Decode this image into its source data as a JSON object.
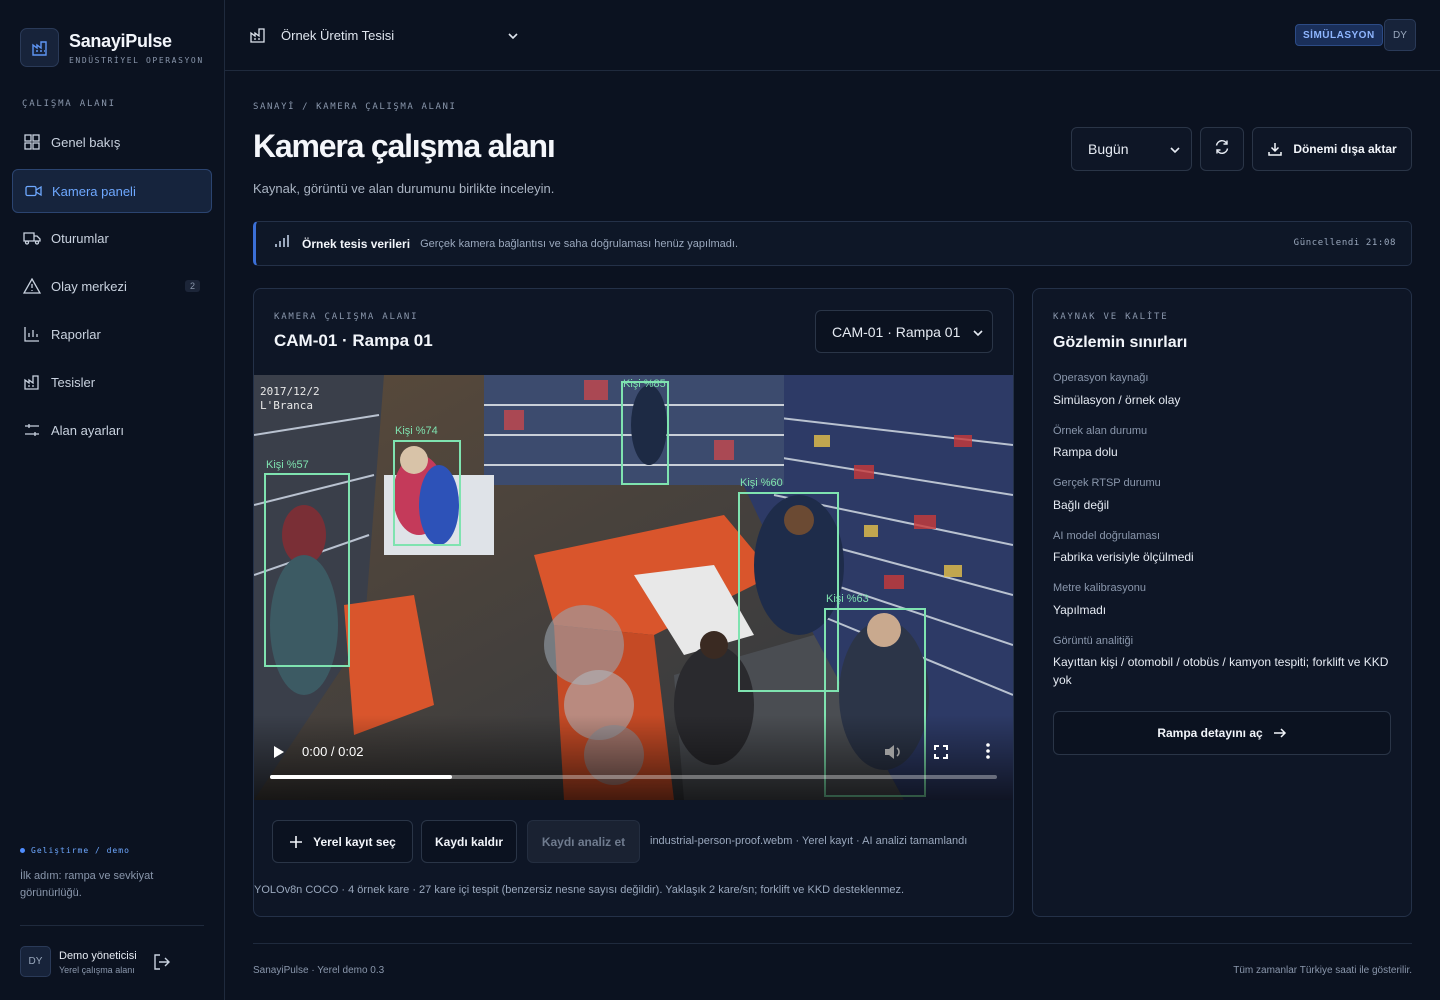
{
  "brand": {
    "name": "SanayiPulse",
    "subtitle": "ENDÜSTRİYEL OPERASYON"
  },
  "sidebar": {
    "section_label": "ÇALIŞMA ALANI",
    "items": [
      {
        "label": "Genel bakış",
        "icon": "grid-icon"
      },
      {
        "label": "Kamera paneli",
        "icon": "video-camera-icon",
        "active": true
      },
      {
        "label": "Oturumlar",
        "icon": "truck-icon"
      },
      {
        "label": "Olay merkezi",
        "icon": "warning-triangle-icon",
        "badge": "2"
      },
      {
        "label": "Raporlar",
        "icon": "bar-chart-icon"
      },
      {
        "label": "Tesisler",
        "icon": "factory-icon"
      },
      {
        "label": "Alan ayarları",
        "icon": "sliders-icon"
      }
    ],
    "env_label": "Geliştirme / demo",
    "env_text": "İlk adım: rampa ve sevkiyat görünürlüğü.",
    "user": {
      "initials": "DY",
      "name": "Demo yöneticisi",
      "role": "Yerel çalışma alanı"
    }
  },
  "topbar": {
    "facility": "Örnek Üretim Tesisi",
    "mode_badge": "SİMÜLASYON",
    "user_initials": "DY"
  },
  "header": {
    "breadcrumb": "SANAYİ / KAMERA ÇALIŞMA ALANI",
    "title": "Kamera çalışma alanı",
    "subtitle": "Kaynak, görüntü ve alan durumunu birlikte inceleyin.",
    "period": "Bugün",
    "export_label": "Dönemi dışa aktar"
  },
  "notice": {
    "title": "Örnek tesis verileri",
    "text": "Gerçek kamera bağlantısı ve saha doğrulaması henüz yapılmadı.",
    "updated": "Güncellendi 21:08"
  },
  "camera": {
    "eyebrow": "KAMERA ÇALIŞMA ALANI",
    "title": "CAM-01 · Rampa 01",
    "selected": "CAM-01 · Rampa 01",
    "stamp_date": "2017/12/2",
    "stamp_loc": "L'Branca",
    "video_time": "0:00 / 0:02",
    "progress": 0.25,
    "detections": [
      {
        "label": "Kişi %57"
      },
      {
        "label": "Kişi %74"
      },
      {
        "label": "Kişi %85"
      },
      {
        "label": "Kişi %60"
      },
      {
        "label": "Kişi %63"
      }
    ],
    "buttons": {
      "select": "Yerel kayıt seç",
      "remove": "Kaydı kaldır",
      "analyze": "Kaydı analiz et"
    },
    "record_info": "industrial-person-proof.webm · Yerel kayıt · AI analizi tamamlandı",
    "model_info": "YOLOv8n COCO · 4 örnek kare · 27 kare içi tespit (benzersiz nesne sayısı değildir). Yaklaşık 2 kare/sn; forklift ve KKD desteklenmez."
  },
  "source": {
    "eyebrow": "KAYNAK VE KALİTE",
    "title": "Gözlemin sınırları",
    "items": [
      {
        "label": "Operasyon kaynağı",
        "value": "Simülasyon / örnek olay"
      },
      {
        "label": "Örnek alan durumu",
        "value": "Rampa dolu"
      },
      {
        "label": "Gerçek RTSP durumu",
        "value": "Bağlı değil"
      },
      {
        "label": "AI model doğrulaması",
        "value": "Fabrika verisiyle ölçülmedi"
      },
      {
        "label": "Metre kalibrasyonu",
        "value": "Yapılmadı"
      },
      {
        "label": "Görüntü analitiği",
        "value": "Kayıttan kişi / otomobil / otobüs / kamyon tespiti; forklift ve KKD yok"
      }
    ],
    "detail_button": "Rampa detayını aç"
  },
  "footer": {
    "left": "SanayiPulse · Yerel demo 0.3",
    "right": "Tüm zamanlar Türkiye saati ile gösterilir."
  }
}
